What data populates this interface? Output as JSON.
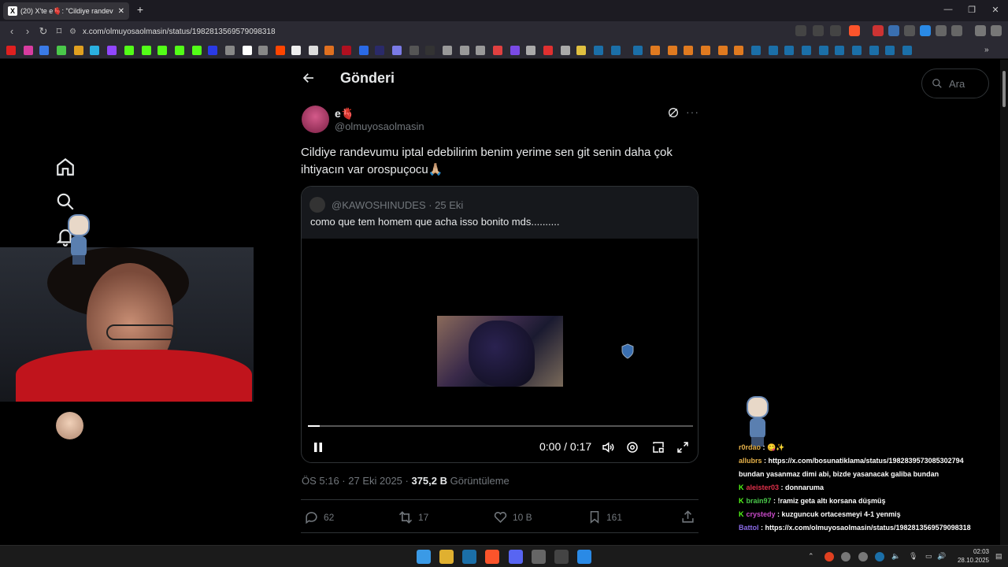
{
  "browser": {
    "tab_title": "(20) X'te e🫀: \"Cildiye randev",
    "url": "x.com/olmuyosaolmasin/status/1982813569579098318",
    "window_controls": [
      "—",
      "❐",
      "✕"
    ]
  },
  "sidebar": {
    "icons": [
      "home-icon",
      "search-icon",
      "notifications-icon"
    ]
  },
  "header": {
    "title": "Gönderi"
  },
  "search": {
    "placeholder": "Ara"
  },
  "tweet": {
    "author_name": "e🫀",
    "author_handle": "@olmuyosaolmasin",
    "text": "Cildiye randevumu iptal edebilirim benim yerime sen git senin daha çok ihtiyacın var orospuçocu🙏🏼",
    "quote": {
      "handle": "@KAWOSHINUDES · 25 Eki",
      "text": "como que tem homem que acha isso bonito mds..........",
      "video_time": "0:00 / 0:17",
      "progress": 0.03
    },
    "timestamp": "ÖS 5:16 · 27 Eki 2025 · ",
    "views_count": "375,2 B",
    "views_label": " Görüntüleme",
    "actions": {
      "replies": "62",
      "reposts": "17",
      "likes": "10 B",
      "bookmarks": "161"
    }
  },
  "chat": [
    {
      "user": "r0rdao",
      "color": "#e6b24a",
      "text": " : 😋✨"
    },
    {
      "user": "allubrs",
      "color": "#e6b24a",
      "text": " : https://x.com/bosunatiklama/status/1982839573085302794"
    },
    {
      "user": "",
      "color": "#ffffff",
      "text": "bundan yasanmaz dimi abi, bizde yasanacak galiba bundan"
    },
    {
      "user": "aleister03",
      "color": "#e0304a",
      "badge": "K",
      "text": " : donnaruma"
    },
    {
      "user": "brain97",
      "color": "#4ac84a",
      "badge": "K",
      "text": " : !ramiz geta altı korsana düşmüş"
    },
    {
      "user": "crystedy",
      "color": "#c84ac8",
      "badge": "K",
      "text": " : kuzguncuk ortacesmeyi 4-1 yenmiş"
    },
    {
      "user": "Battol",
      "color": "#8a6ae6",
      "text": " : https://x.com/olmuyosaolmasin/status/1982813569579098318"
    }
  ],
  "taskbar": {
    "time": "02:03",
    "date": "28.10.2025"
  },
  "colors": {
    "background": "#000000",
    "muted": "#71767b",
    "text": "#e7e9ea",
    "border": "#2f3336"
  }
}
